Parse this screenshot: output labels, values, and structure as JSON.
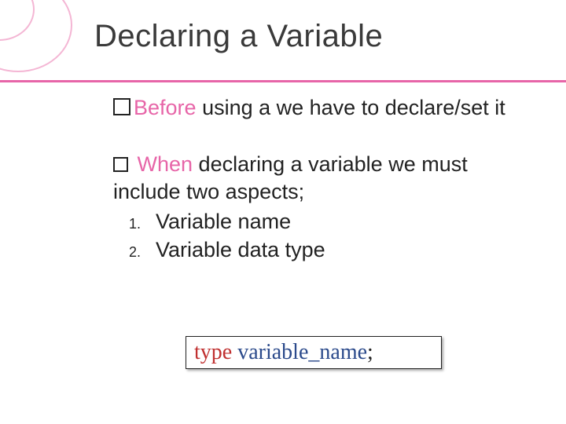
{
  "title": "Declaring a Variable",
  "p1_part1": "Before",
  "p1_part2": " using a we have to declare/set it",
  "p2_part1": " When",
  "p2_part2": " declaring a variable we must include two aspects;",
  "ol": {
    "n1": "1.",
    "i1": "Variable name",
    "n2": "2.",
    "i2": "Variable data type"
  },
  "code": {
    "type": "type",
    "space": " ",
    "var": "variable_name",
    "semi": ";"
  }
}
